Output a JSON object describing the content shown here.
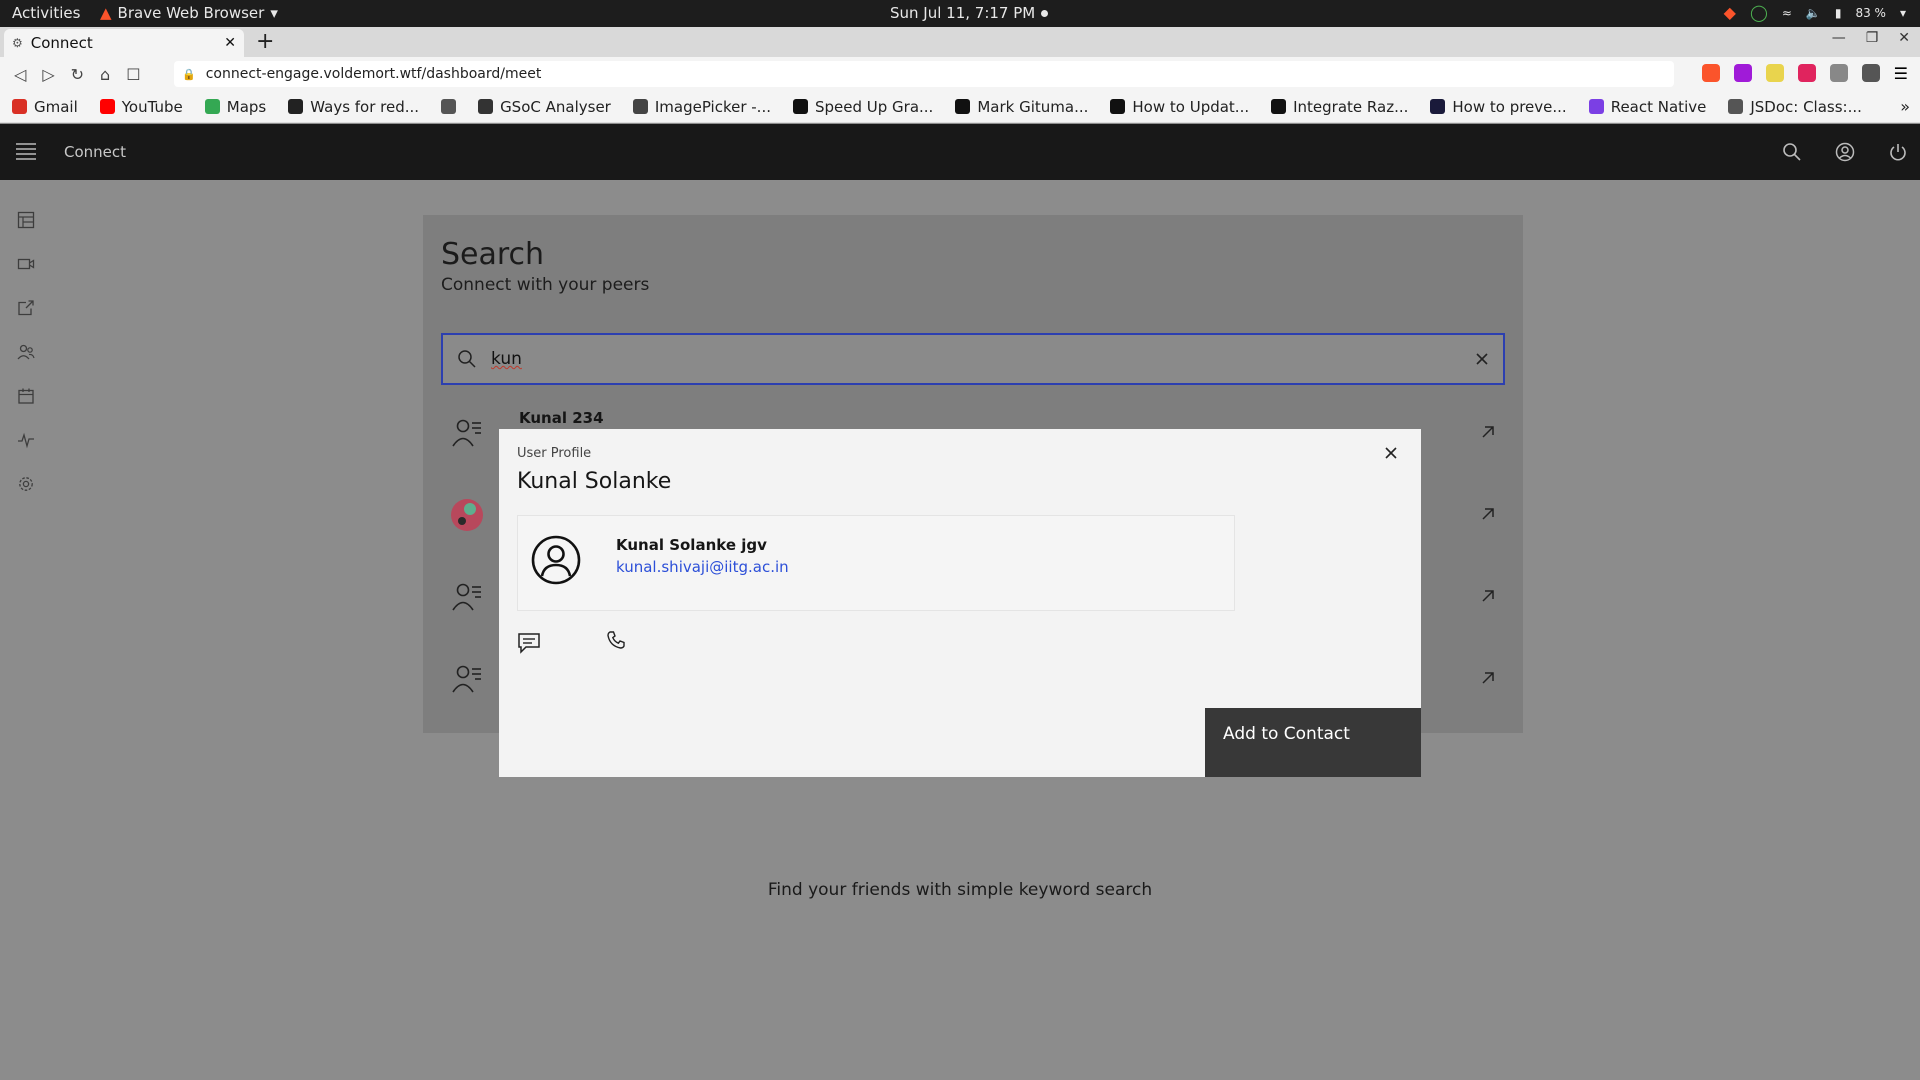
{
  "system_bar": {
    "activities": "Activities",
    "app_name": "Brave Web Browser",
    "clock": "Sun Jul 11,  7:17 PM",
    "battery": "83 %"
  },
  "browser": {
    "tab_title": "Connect",
    "url": "connect-engage.voldemort.wtf/dashboard/meet",
    "bookmarks": [
      {
        "label": "Gmail",
        "color": "#d93025"
      },
      {
        "label": "YouTube",
        "color": "#ff0000"
      },
      {
        "label": "Maps",
        "color": "#34a853"
      },
      {
        "label": "Ways for red...",
        "color": "#222222"
      },
      {
        "label": "",
        "color": "#555555"
      },
      {
        "label": "GSoC Analyser",
        "color": "#333333"
      },
      {
        "label": "ImagePicker -...",
        "color": "#444444"
      },
      {
        "label": "Speed Up Gra...",
        "color": "#111111"
      },
      {
        "label": "Mark Gituma...",
        "color": "#111111"
      },
      {
        "label": "How to Updat...",
        "color": "#111111"
      },
      {
        "label": "Integrate Raz...",
        "color": "#111111"
      },
      {
        "label": "How to preve...",
        "color": "#1a1a3a"
      },
      {
        "label": "React Native",
        "color": "#7b3fe4"
      },
      {
        "label": "JSDoc: Class:...",
        "color": "#555555"
      }
    ],
    "bookmarks_more": "»"
  },
  "app": {
    "brand": "Connect"
  },
  "search": {
    "title": "Search",
    "subtitle": "Connect with your peers",
    "query": "kun",
    "results": [
      {
        "name": "Kunal 234",
        "icon": "user-list-icon"
      },
      {
        "name": "",
        "icon": "avatar-image"
      },
      {
        "name": "",
        "icon": "user-list-icon"
      },
      {
        "name": "",
        "icon": "user-list-icon"
      }
    ],
    "empty_hint": "Find your friends with simple keyword search"
  },
  "modal": {
    "label": "User Profile",
    "title": "Kunal Solanke",
    "user_name": "Kunal Solanke jgv",
    "user_email": "kunal.shivaji@iitg.ac.in",
    "add_button": "Add to Contact"
  },
  "colors": {
    "accent_blue": "#2c3fb0",
    "header_bg": "#181818",
    "overlay_bg": "#8c8c8c",
    "primary_button": "#383838",
    "link": "#2c4fd8"
  }
}
